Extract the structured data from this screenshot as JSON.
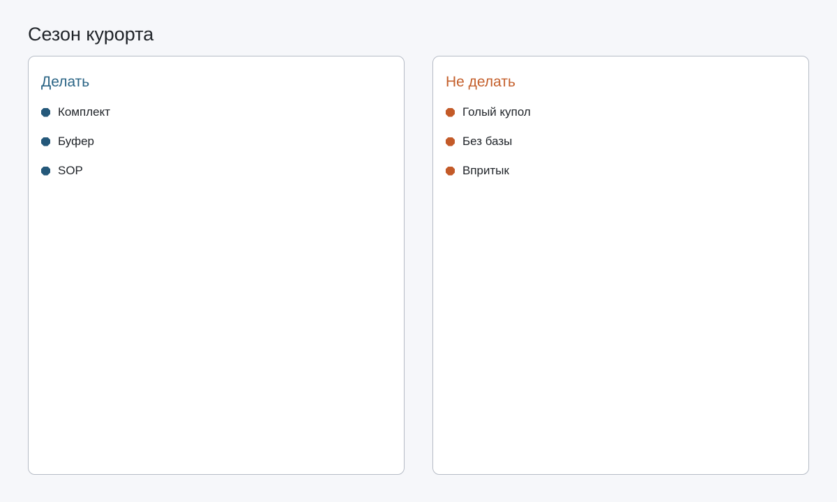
{
  "page": {
    "title": "Сезон курорта"
  },
  "colors": {
    "do": "#2a6485",
    "dont": "#c45f2b",
    "do_dot": "#24587a",
    "dont_dot": "#c35a28"
  },
  "do_card": {
    "title": "Делать",
    "items": [
      {
        "label": "Комплект"
      },
      {
        "label": "Буфер"
      },
      {
        "label": "SOP"
      }
    ]
  },
  "dont_card": {
    "title": "Не делать",
    "items": [
      {
        "label": "Голый купол"
      },
      {
        "label": "Без базы"
      },
      {
        "label": "Впритык"
      }
    ]
  }
}
